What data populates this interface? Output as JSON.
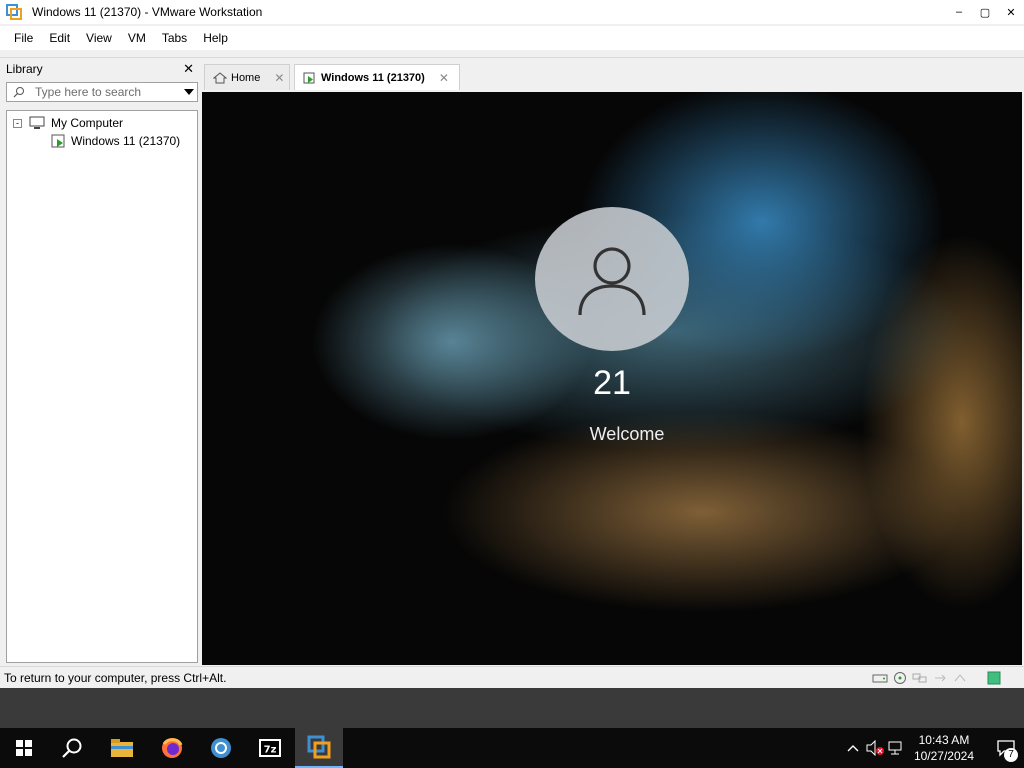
{
  "window": {
    "title": "Windows 11 (21370) - VMware Workstation",
    "icon": "vmware-icon"
  },
  "menubar": {
    "items": [
      "File",
      "Edit",
      "View",
      "VM",
      "Tabs",
      "Help"
    ]
  },
  "library": {
    "title": "Library",
    "search_placeholder": "Type here to search",
    "tree": [
      {
        "label": "My Computer",
        "icon": "computer-icon",
        "expanded": true
      },
      {
        "label": "Windows 11 (21370)",
        "icon": "vm-running-icon"
      }
    ]
  },
  "tabs": [
    {
      "label": "Home",
      "icon": "home-icon",
      "active": false
    },
    {
      "label": "Windows 11 (21370)",
      "icon": "vm-running-icon",
      "active": true
    }
  ],
  "vm_screen": {
    "username": "21",
    "status": "Welcome"
  },
  "statusbar": {
    "message": "To return to your computer, press Ctrl+Alt."
  },
  "taskbar": {
    "apps": [
      "start-icon",
      "search-icon",
      "file-explorer-icon",
      "firefox-icon",
      "chrome-icon",
      "7zip-icon",
      "vmware-icon"
    ],
    "time": "10:43 AM",
    "date": "10/27/2024",
    "notifications": "7"
  }
}
